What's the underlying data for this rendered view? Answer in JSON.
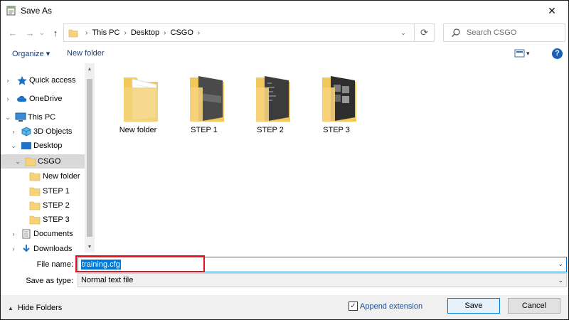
{
  "window": {
    "title": "Save As",
    "close_glyph": "✕"
  },
  "nav": {
    "back_glyph": "←",
    "forward_glyph": "→",
    "recent_glyph": "⌄",
    "up_glyph": "↑"
  },
  "address": {
    "crumbs": [
      "This PC",
      "Desktop",
      "CSGO"
    ],
    "separator": "›"
  },
  "search": {
    "placeholder": "Search CSGO"
  },
  "toolbar": {
    "organize": "Organize ▾",
    "new_folder": "New folder",
    "view_glyph": "▾",
    "help_glyph": "?"
  },
  "tree": {
    "items": [
      {
        "label": "Quick access",
        "icon": "star-icon",
        "chevron": "›"
      },
      {
        "label": "OneDrive",
        "icon": "cloud-icon",
        "chevron": "›"
      },
      {
        "label": "This PC",
        "icon": "computer-icon",
        "chevron": "⌄"
      },
      {
        "label": "3D Objects",
        "icon": "cube-icon",
        "chevron": "›"
      },
      {
        "label": "Desktop",
        "icon": "desktop-icon",
        "chevron": "⌄"
      },
      {
        "label": "CSGO",
        "icon": "folder-icon",
        "chevron": "⌄"
      },
      {
        "label": "New folder",
        "icon": "folder-icon",
        "chevron": ""
      },
      {
        "label": "STEP 1",
        "icon": "folder-icon",
        "chevron": ""
      },
      {
        "label": "STEP 2",
        "icon": "folder-icon",
        "chevron": ""
      },
      {
        "label": "STEP 3",
        "icon": "folder-icon",
        "chevron": ""
      },
      {
        "label": "Documents",
        "icon": "documents-icon",
        "chevron": "›"
      },
      {
        "label": "Downloads",
        "icon": "download-icon",
        "chevron": "›"
      }
    ],
    "selected": "CSGO"
  },
  "files": [
    {
      "name": "New folder",
      "kind": "empty-folder"
    },
    {
      "name": "STEP 1",
      "kind": "image-folder"
    },
    {
      "name": "STEP 2",
      "kind": "image-folder"
    },
    {
      "name": "STEP 3",
      "kind": "image-folder"
    }
  ],
  "form": {
    "file_name_label": "File name:",
    "file_name_value": "training.cfg",
    "save_as_type_label": "Save as type:",
    "save_as_type_value": "Normal text file",
    "dropdown_glyph": "⌄"
  },
  "footer": {
    "hide_folders": "Hide Folders",
    "append_extension": "Append extension",
    "append_checked": true,
    "save": "Save",
    "cancel": "Cancel"
  },
  "colors": {
    "accent": "#0078d7",
    "highlight": "#e81123",
    "folder": "#f6d27a"
  }
}
